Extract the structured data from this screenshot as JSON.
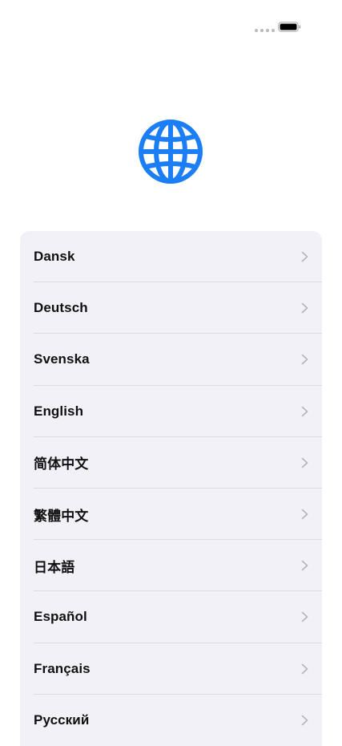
{
  "status_bar": {
    "battery_level": 1.0
  },
  "header": {
    "icon": "globe-icon",
    "accent_color": "#1b7ef7"
  },
  "languages": [
    {
      "label": "Dansk"
    },
    {
      "label": "Deutsch"
    },
    {
      "label": "Svenska"
    },
    {
      "label": "English"
    },
    {
      "label": "简体中文"
    },
    {
      "label": "繁體中文"
    },
    {
      "label": "日本語"
    },
    {
      "label": "Español"
    },
    {
      "label": "Français"
    },
    {
      "label": "Русский"
    }
  ],
  "row_chevron_icon": "chevron-right-icon"
}
